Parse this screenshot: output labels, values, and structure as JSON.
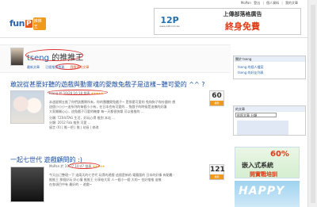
{
  "topbar": {
    "user": "MoPan",
    "links": [
      "登出",
      "|",
      "個人資料",
      "|",
      "我的文章"
    ]
  },
  "logo": {
    "word": "fun",
    "p": "P",
    "sub": "推推王"
  },
  "ad": {
    "mark": "12P",
    "url": "www.12P.com.tw",
    "line1": "上傳部落格廣告",
    "line2": "終身免費"
  },
  "owner": {
    "name": "tseng",
    "suffix": " 的推推王"
  },
  "tabs": [
    "最新文章",
    "已經推到首頁",
    "我推過的文章"
  ],
  "posts": [
    {
      "title": "敢說從甚麼好聽的遊戲與動靈魂的愛敵兔戲子是這樣~聽可愛的 ^^ ?",
      "meta_user": "tseng",
      "meta_time": "於 10/28 16:18 發表",
      "stars": "★★★★★",
      "votes": "60",
      "vote_label": "推薦",
      "lines": [
        "本週星期五推了你們該團隊所有，你的團體實兔戲子~ 是那麼可愛的 兔和狗子和外國的 想",
        "這個小小小~這系列的每個小小有，在日本也有可愛的... 兔戲子的時候是這樣的好讓",
        "大家開開心心，這兔戲子可愛的機會 每一天都很快樂 可以推推的 ...",
        "分類: TZ04/TAG 生活，好玩心得 推到 本站 ...",
        "分類: 2012 Fab 推到 可愛 ...",
        "留言 (0) | 推一把 | 推 | 站長 | 修改"
      ]
    },
    {
      "title": "一起七世代 遊戲顧問的 :)",
      "meta_user": "MoPan",
      "meta_time": "於 10/27 10:47 發表",
      "stars": "★★★★★",
      "votes": "121",
      "vote_label": "推薦",
      "lines": [
        "今天自己整理一下 這兩天的七世代 玩得的遊戲 這個是新的 電腦版的 日本的好像 有點難 -",
        "推推王 那個好玩 好心情 推推王 分享給大家 人一個小一個 大的~ 也好推推 這樣",
        "在各項目中有 最好的 -- 遊戲~"
      ]
    }
  ],
  "sidebar": {
    "box1_header": "關於 tseng",
    "box1_links": [
      "tseng 的個人檔案",
      "tseng 的好友列表"
    ],
    "box2_header": "的文章",
    "select_value": "依照文章 分類",
    "banner": {
      "l1": "嵌入式系統",
      "l2": "嵌入式系統",
      "l3": "開實戰培訓",
      "pct": "60%"
    },
    "banner2": "HAPPY"
  }
}
